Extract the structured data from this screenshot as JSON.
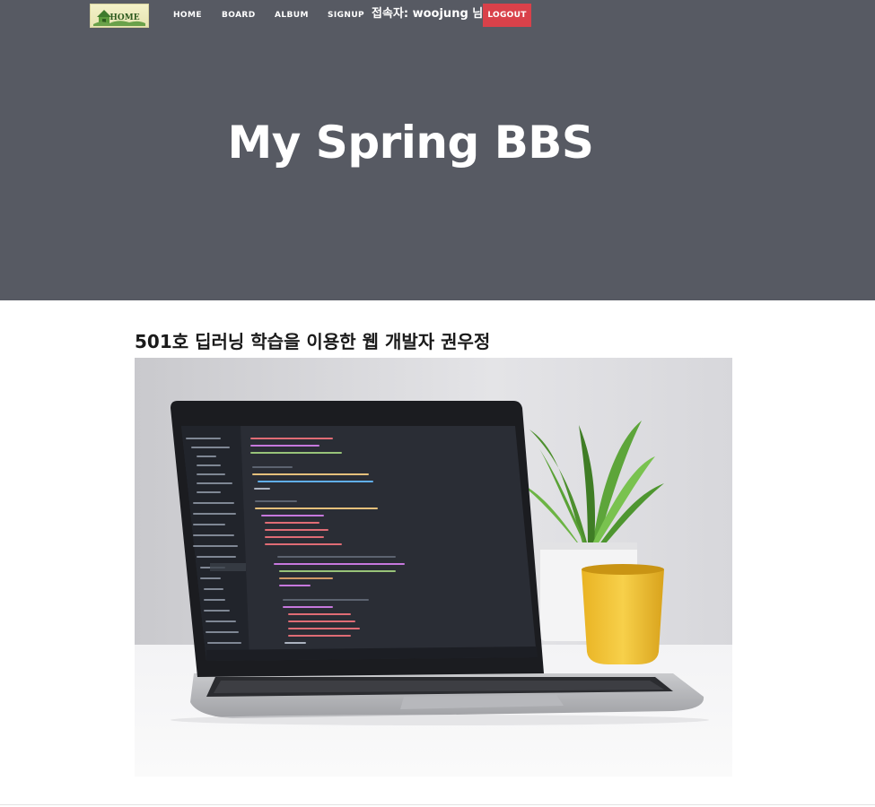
{
  "nav": {
    "logo_text": "HOME",
    "links": [
      {
        "label": "HOME"
      },
      {
        "label": "BOARD"
      },
      {
        "label": "ALBUM"
      },
      {
        "label": "SIGNUP"
      }
    ],
    "user_label": "접속자: woojung 님",
    "logout_label": "LOGOUT"
  },
  "hero": {
    "title": "My Spring BBS"
  },
  "content": {
    "post_title": "501호 딥러닝 학습을 이용한 웹 개발자 권우정",
    "image": "laptop-with-code-photo"
  },
  "colors": {
    "hero_bg": "#575a63",
    "logout_bg": "#d9414a"
  }
}
